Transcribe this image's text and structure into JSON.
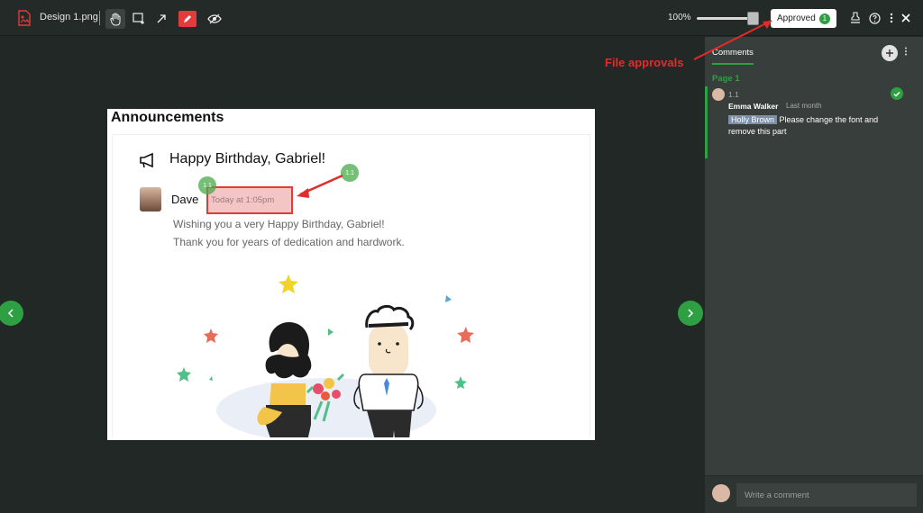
{
  "toolbar": {
    "file_name": "Design 1.png",
    "zoom_label": "100%",
    "zoom_level_percent": 100,
    "approved_label": "Approved",
    "approved_count": "1",
    "tools": [
      "hand-icon",
      "select-rect-icon",
      "arrow-icon",
      "pen-icon",
      "eye-icon"
    ],
    "right_tools": [
      "stamp-icon",
      "help-icon",
      "more-icon",
      "close-icon"
    ]
  },
  "document": {
    "heading": "Announcements",
    "title": "Happy Birthday, Gabriel!",
    "author": "Dave",
    "timestamp": "Today at 1:05pm",
    "message_line1": "Wishing you a very Happy Birthday, Gabriel!",
    "message_line2": "Thank you for years of dedication and hardwork.",
    "pins": [
      "1.1",
      "1.1"
    ]
  },
  "annotation": {
    "label": "File approvals",
    "color": "#e52a2a"
  },
  "sidebar": {
    "tab_label": "Comments",
    "page_label": "Page 1",
    "comment": {
      "index": "1.1",
      "author": "Emma Walker",
      "time": "Last month",
      "mention": "Holly Brown",
      "text": "Please change the font and remove this part"
    },
    "input_placeholder": "Write a comment"
  },
  "colors": {
    "accent": "#2ea043",
    "background": "#222826",
    "sidebar": "#383e3c",
    "annotation_red": "#e23b3b"
  }
}
